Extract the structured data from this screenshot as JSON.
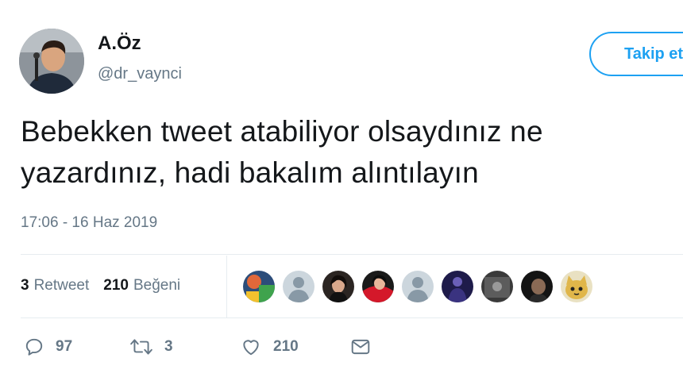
{
  "user": {
    "display_name": "A.Öz",
    "handle": "@dr_vaynci",
    "follow_label": "Takip et"
  },
  "tweet": {
    "line1": "Bebekken tweet atabiliyor olsaydınız ne",
    "line2": "yazardınız, hadi bakalım alıntılayın",
    "timestamp": "17:06 - 16 Haz 2019"
  },
  "stats": {
    "retweet_count": "3",
    "retweet_label": "Retweet",
    "like_count": "210",
    "like_label": "Beğeni"
  },
  "actions": {
    "reply_count": "97",
    "retweet_count": "3",
    "like_count": "210"
  },
  "icons": [
    "reply-icon",
    "retweet-icon",
    "like-icon",
    "message-icon"
  ],
  "colors": {
    "accent": "#1da1f2",
    "muted": "#657786",
    "text": "#14171a"
  }
}
